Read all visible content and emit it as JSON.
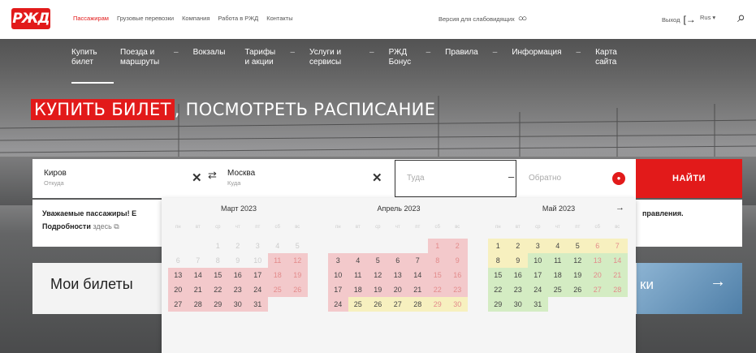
{
  "topnav": {
    "items": [
      "Пассажирам",
      "Грузовые перевозки",
      "Компания",
      "Работа в РЖД",
      "Контакты"
    ]
  },
  "logo_text": "РЖД",
  "accessible_label": "Версия для слабовидящих",
  "logout_label": "Выход",
  "lang_label": "Rus ▾",
  "mainnav": [
    {
      "label": "Купить билет"
    },
    {
      "label": "Поезда и маршруты"
    },
    {
      "label": "Вокзалы"
    },
    {
      "label": "Тарифы и акции"
    },
    {
      "label": "Услуги и сервисы"
    },
    {
      "label": "РЖД Бонус"
    },
    {
      "label": "Правила"
    },
    {
      "label": "Информация"
    },
    {
      "label": "Карта сайта"
    }
  ],
  "headline": {
    "highlight": "КУПИТЬ БИЛЕТ",
    "rest": ", ПОСМОТРЕТЬ РАСПИСАНИЕ"
  },
  "form": {
    "from": {
      "value": "Киров",
      "sub": "Откуда"
    },
    "to": {
      "value": "Москва",
      "sub": "Куда"
    },
    "date_there_placeholder": "Туда",
    "date_back_placeholder": "Обратно",
    "find_label": "НАЙТИ"
  },
  "notice": {
    "line1": "Уважаемые пассажиры! Е",
    "line1_right": "правления.",
    "line2_bold": "Подробности",
    "line2_link": " здесь"
  },
  "card": {
    "title": "Мои билеты",
    "img_text": "ки"
  },
  "colors": {
    "accent": "#e21a1a",
    "past": "#f3c9cb",
    "yellow": "#f7f0bf",
    "green": "#d4ecc3"
  },
  "calendar": {
    "weekdays": [
      "пн",
      "вт",
      "ср",
      "чт",
      "пт",
      "сб",
      "вс"
    ],
    "months": [
      {
        "title": "Март 2023",
        "offset": 2,
        "days": 31,
        "past_to": 10,
        "red_from": 11,
        "red_to": 31,
        "yellow_from": 0,
        "yellow_to": 0,
        "green_from": 0,
        "green_to": 0
      },
      {
        "title": "Апрель 2023",
        "offset": 5,
        "days": 30,
        "past_to": 0,
        "red_from": 1,
        "red_to": 24,
        "yellow_from": 25,
        "yellow_to": 30,
        "green_from": 0,
        "green_to": 0
      },
      {
        "title": "Май 2023",
        "offset": 0,
        "days": 31,
        "past_to": 0,
        "red_from": 0,
        "red_to": 0,
        "yellow_from": 1,
        "yellow_to": 9,
        "green_from": 10,
        "green_to": 31
      }
    ]
  }
}
